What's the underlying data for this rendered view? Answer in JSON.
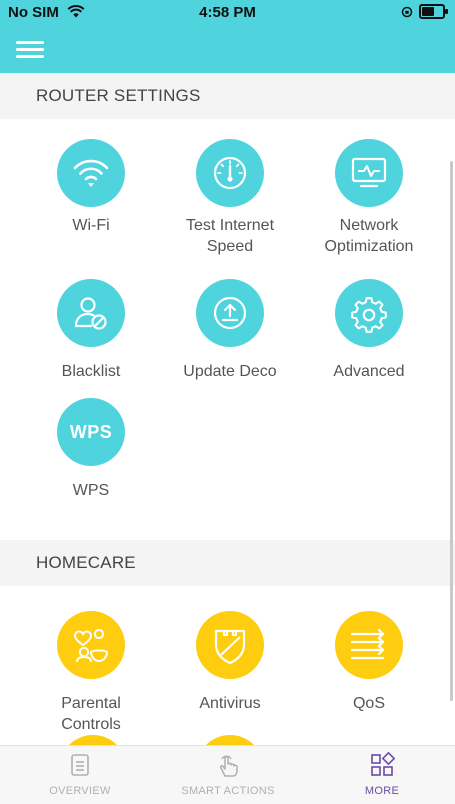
{
  "status_bar": {
    "carrier": "No SIM",
    "time": "4:58 PM",
    "battery_level": 0.65
  },
  "header": {
    "menu_icon": "hamburger-icon"
  },
  "router_settings": {
    "title": "ROUTER SETTINGS",
    "items": [
      {
        "label": "Wi-Fi",
        "icon": "wifi-icon"
      },
      {
        "label": "Test Internet Speed",
        "icon": "speedometer-icon"
      },
      {
        "label": "Network Optimization",
        "icon": "network-monitor-icon"
      },
      {
        "label": "Blacklist",
        "icon": "blocked-user-icon"
      },
      {
        "label": "Update Deco",
        "icon": "upload-icon"
      },
      {
        "label": "Advanced",
        "icon": "gear-icon"
      },
      {
        "label": "WPS",
        "icon": "wps-icon",
        "icon_text": "WPS"
      }
    ]
  },
  "homecare": {
    "title": "HOMECARE",
    "items": [
      {
        "label": "Parental Controls",
        "icon": "parental-icon"
      },
      {
        "label": "Antivirus",
        "icon": "shield-icon"
      },
      {
        "label": "QoS",
        "icon": "qos-icon"
      }
    ]
  },
  "bottom_nav": {
    "items": [
      {
        "label": "OVERVIEW",
        "icon": "document-icon"
      },
      {
        "label": "SMART ACTIONS",
        "icon": "tap-icon"
      },
      {
        "label": "MORE",
        "icon": "grid-icon"
      }
    ]
  },
  "colors": {
    "accent_teal": "#4fd3dc",
    "homecare_yellow": "#ffcd0f",
    "active_nav": "#6b4aa6"
  }
}
